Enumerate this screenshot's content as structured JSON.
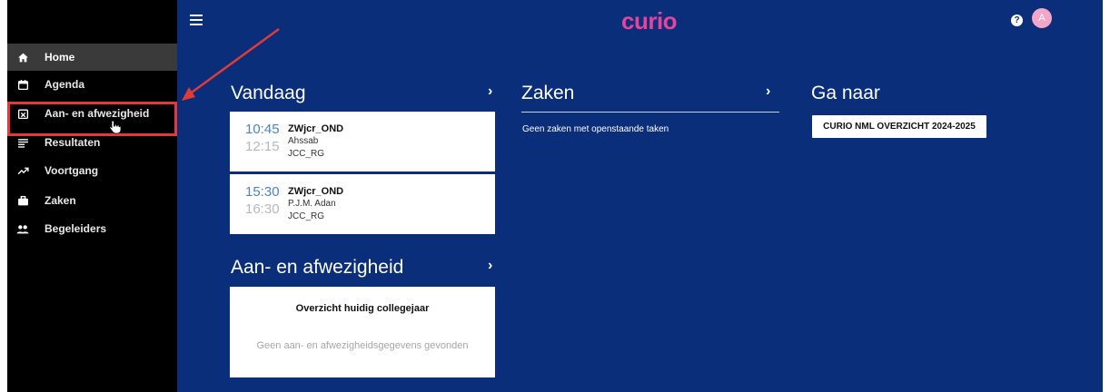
{
  "app": {
    "logo": "curio"
  },
  "header": {
    "help_label": "?",
    "avatar_initial": "A"
  },
  "sidebar": {
    "items": [
      {
        "label": "Home",
        "icon": "home-icon",
        "active": true
      },
      {
        "label": "Agenda",
        "icon": "calendar-icon"
      },
      {
        "label": "Aan- en afwezigheid",
        "icon": "calendar-x-icon"
      },
      {
        "label": "Resultaten",
        "icon": "list-icon"
      },
      {
        "label": "Voortgang",
        "icon": "trending-up-icon"
      },
      {
        "label": "Zaken",
        "icon": "briefcase-icon"
      },
      {
        "label": "Begeleiders",
        "icon": "people-icon"
      }
    ]
  },
  "vandaag": {
    "title": "Vandaag",
    "appointments": [
      {
        "start": "10:45",
        "end": "12:15",
        "course": "ZWjcr_OND",
        "teacher": "Ahssab",
        "room": "JCC_RG"
      },
      {
        "start": "15:30",
        "end": "16:30",
        "course": "ZWjcr_OND",
        "teacher": "P.J.M. Adan",
        "room": "JCC_RG"
      }
    ]
  },
  "zaken": {
    "title": "Zaken",
    "empty_text": "Geen zaken met openstaande taken"
  },
  "ganaar": {
    "title": "Ga naar",
    "button_label": "CURIO NML OVERZICHT 2024-2025"
  },
  "aanwezigheid": {
    "title": "Aan- en afwezigheid",
    "card_title": "Overzicht huidig collegejaar",
    "empty_text": "Geen aan- en afwezigheidsgegevens gevonden"
  },
  "colors": {
    "background": "#0b2e7a",
    "sidebar": "#000000",
    "accent": "#e2459b",
    "annotation": "#e03a3a"
  }
}
